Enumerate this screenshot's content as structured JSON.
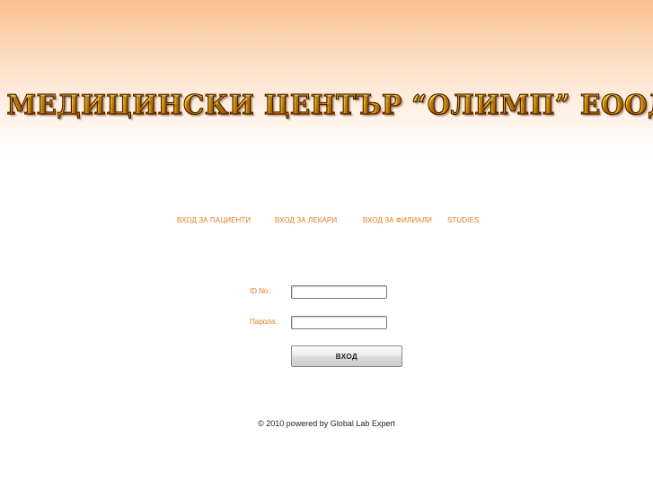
{
  "header": {
    "title": "МЕДИЦИНСКИ ЦЕНТЪР “ОЛИМП” ЕООД"
  },
  "nav": {
    "items": [
      {
        "label": "ВХОД ЗА ПАЦИЕНТИ"
      },
      {
        "label": "ВХОД ЗА ЛЕКАРИ"
      },
      {
        "label": "ВХОД ЗА ФИЛИАЛИ"
      },
      {
        "label": "STUDIES"
      }
    ]
  },
  "login_form": {
    "id_label": "ID No.:",
    "id_value": "",
    "password_label": "Парола:",
    "password_value": "",
    "submit_label": "ВХОД"
  },
  "footer": {
    "text": "© 2010 powered by Global Lab Expert"
  },
  "colors": {
    "accent_orange": "#e07a1a",
    "header_gradient_top": "#f9bf90",
    "title_gold": "#ffc21a",
    "title_outline": "#4a1e00"
  }
}
